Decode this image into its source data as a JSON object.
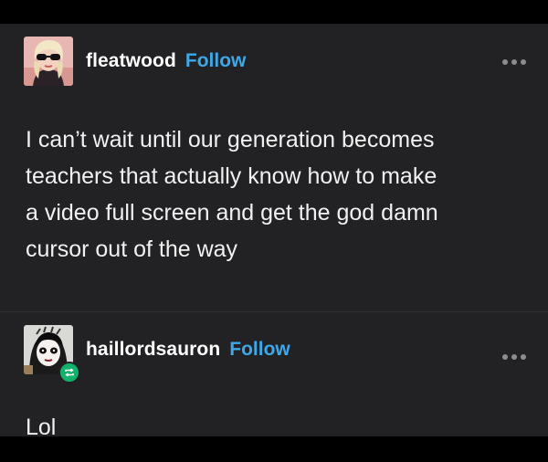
{
  "posts": [
    {
      "username": "fleatwood",
      "follow_label": "Follow",
      "body": "I can’t wait until our generation becomes\nteachers that actually know how to make\na video full screen and get the god damn\ncursor out of the way"
    },
    {
      "username": "haillordsauron",
      "follow_label": "Follow",
      "body": "Lol"
    }
  ],
  "colors": {
    "background": "#222124",
    "follow": "#3fa8e8",
    "text": "#f1f1f1",
    "reblog_badge": "#12b26b"
  },
  "icons": {
    "more": "more-options-icon",
    "reblog": "reblog-icon"
  }
}
